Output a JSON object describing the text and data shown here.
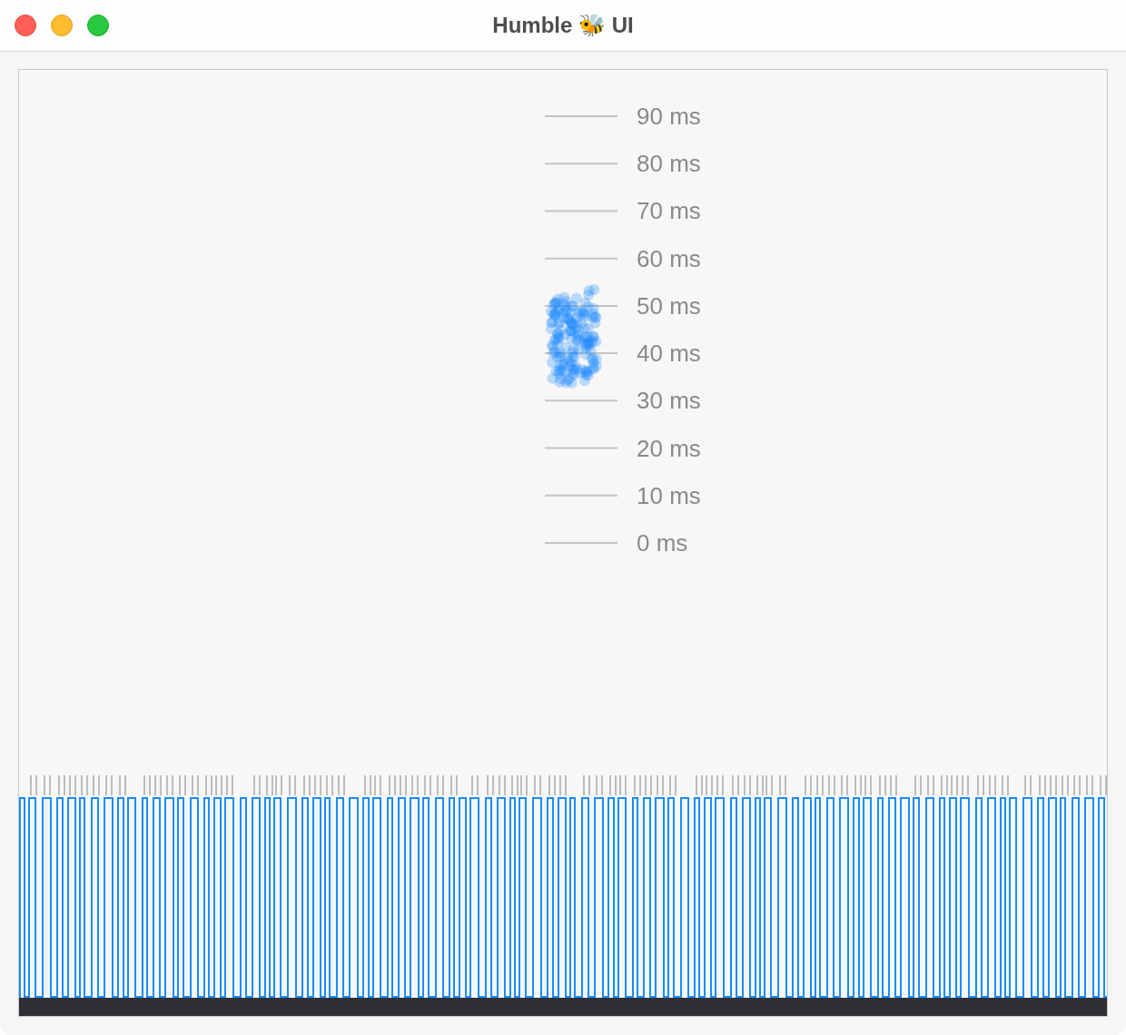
{
  "window": {
    "title": "Humble 🐝 UI"
  },
  "scale": {
    "ticks": [
      "90 ms",
      "80 ms",
      "70 ms",
      "60 ms",
      "50 ms",
      "40 ms",
      "30 ms",
      "20 ms",
      "10 ms",
      "0 ms"
    ]
  }
}
